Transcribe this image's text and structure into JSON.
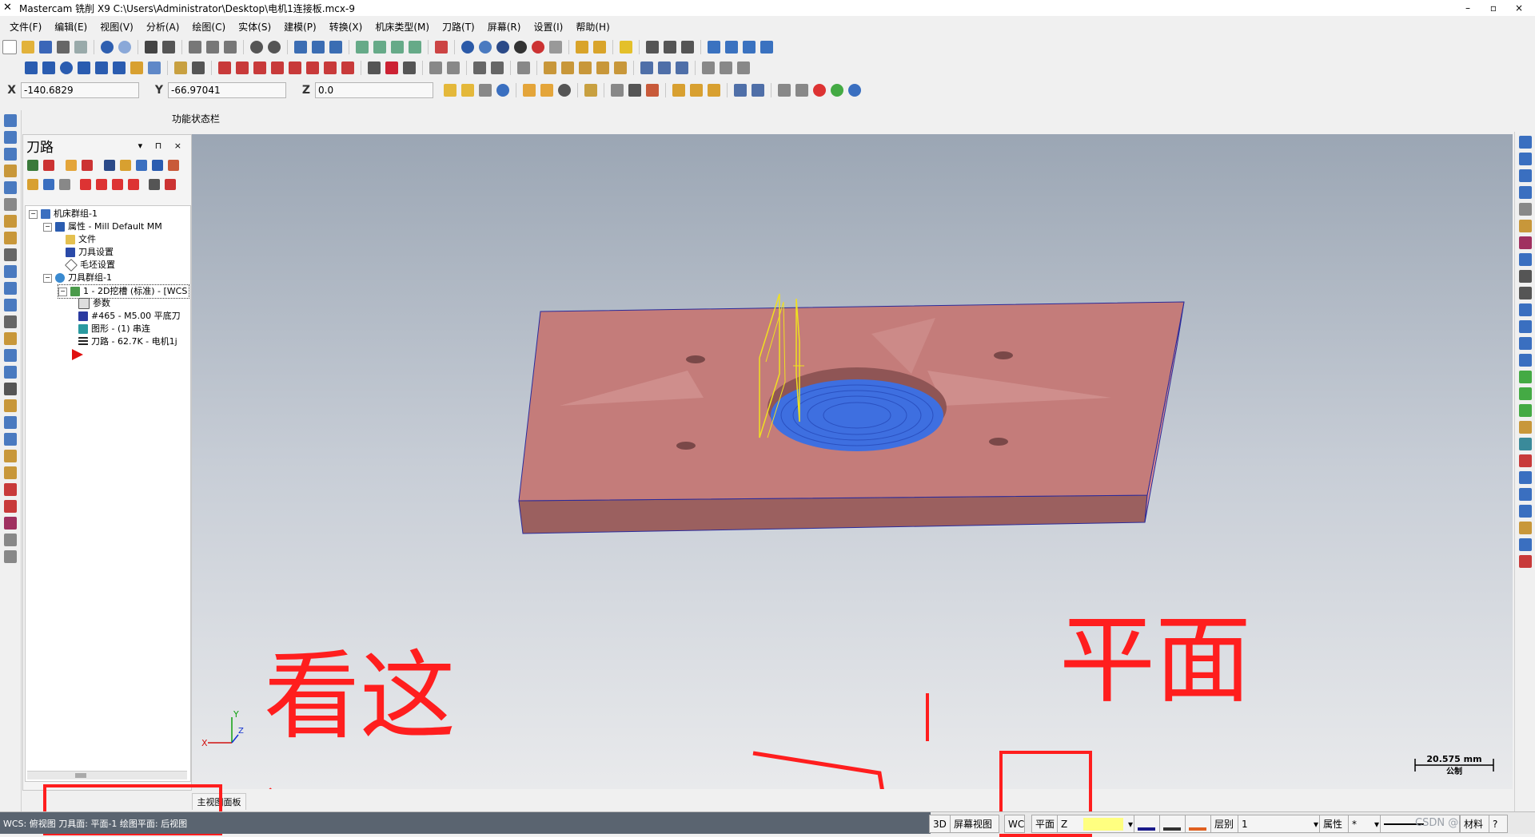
{
  "titlebar": {
    "title": "Mastercam 铣削 X9  C:\\Users\\Administrator\\Desktop\\电机1连接板.mcx-9",
    "minimize": "–",
    "restore": "▫",
    "close": "×"
  },
  "menu": [
    "文件(F)",
    "编辑(E)",
    "视图(V)",
    "分析(A)",
    "绘图(C)",
    "实体(S)",
    "建模(P)",
    "转换(X)",
    "机床类型(M)",
    "刀路(T)",
    "屏幕(R)",
    "设置(I)",
    "帮助(H)"
  ],
  "coords": {
    "x_label": "X",
    "x_value": "-140.6829",
    "y_label": "Y",
    "y_value": "-66.97041",
    "z_label": "Z",
    "z_value": "0.0"
  },
  "function_bar_label": "功能状态栏",
  "panel": {
    "title": "刀路",
    "controls": "▾ ⊓ ×",
    "tree": {
      "machine_group": "机床群组-1",
      "properties": "属性 - Mill Default MM",
      "files": "文件",
      "tool_settings": "刀具设置",
      "stock_settings": "毛坯设置",
      "toolpath_group": "刀具群组-1",
      "operation": "1 - 2D挖槽 (标准) - [WCS",
      "params": "参数",
      "tool": "#465 - M5.00 平底刀",
      "geometry": "图形 - (1) 串连",
      "toolpath": "刀路 - 62.7K - 电机1j"
    },
    "bottom_tab": "主视图面板"
  },
  "viewport": {
    "axis_x": "X",
    "axis_y": "Y",
    "axis_z": "Z",
    "scale_value": "20.575 mm",
    "scale_unit": "公制"
  },
  "annotations": {
    "left_text": "看这",
    "right_text": "平面"
  },
  "statusbar": {
    "wcs": "WCS: 俯视图  刀具面: 平面-1  绘图平面: 后视图",
    "mode_3d": "3D",
    "screen_view": "屏幕视图",
    "wcs_short": "WC",
    "plane": "平面",
    "z_label": "Z",
    "layer_label": "层别",
    "layer_value": "1",
    "attr_label": "属性",
    "attr_value": "*",
    "watermark": "CSDN @cnnnnn",
    "material": "材料",
    "help": "?"
  },
  "colors": {
    "part_face": "#c47c7a",
    "part_side": "#a56462",
    "pocket": "#3e6fe0",
    "toolpath_lines": "#f0e020",
    "annotation": "#ff1e1e"
  }
}
